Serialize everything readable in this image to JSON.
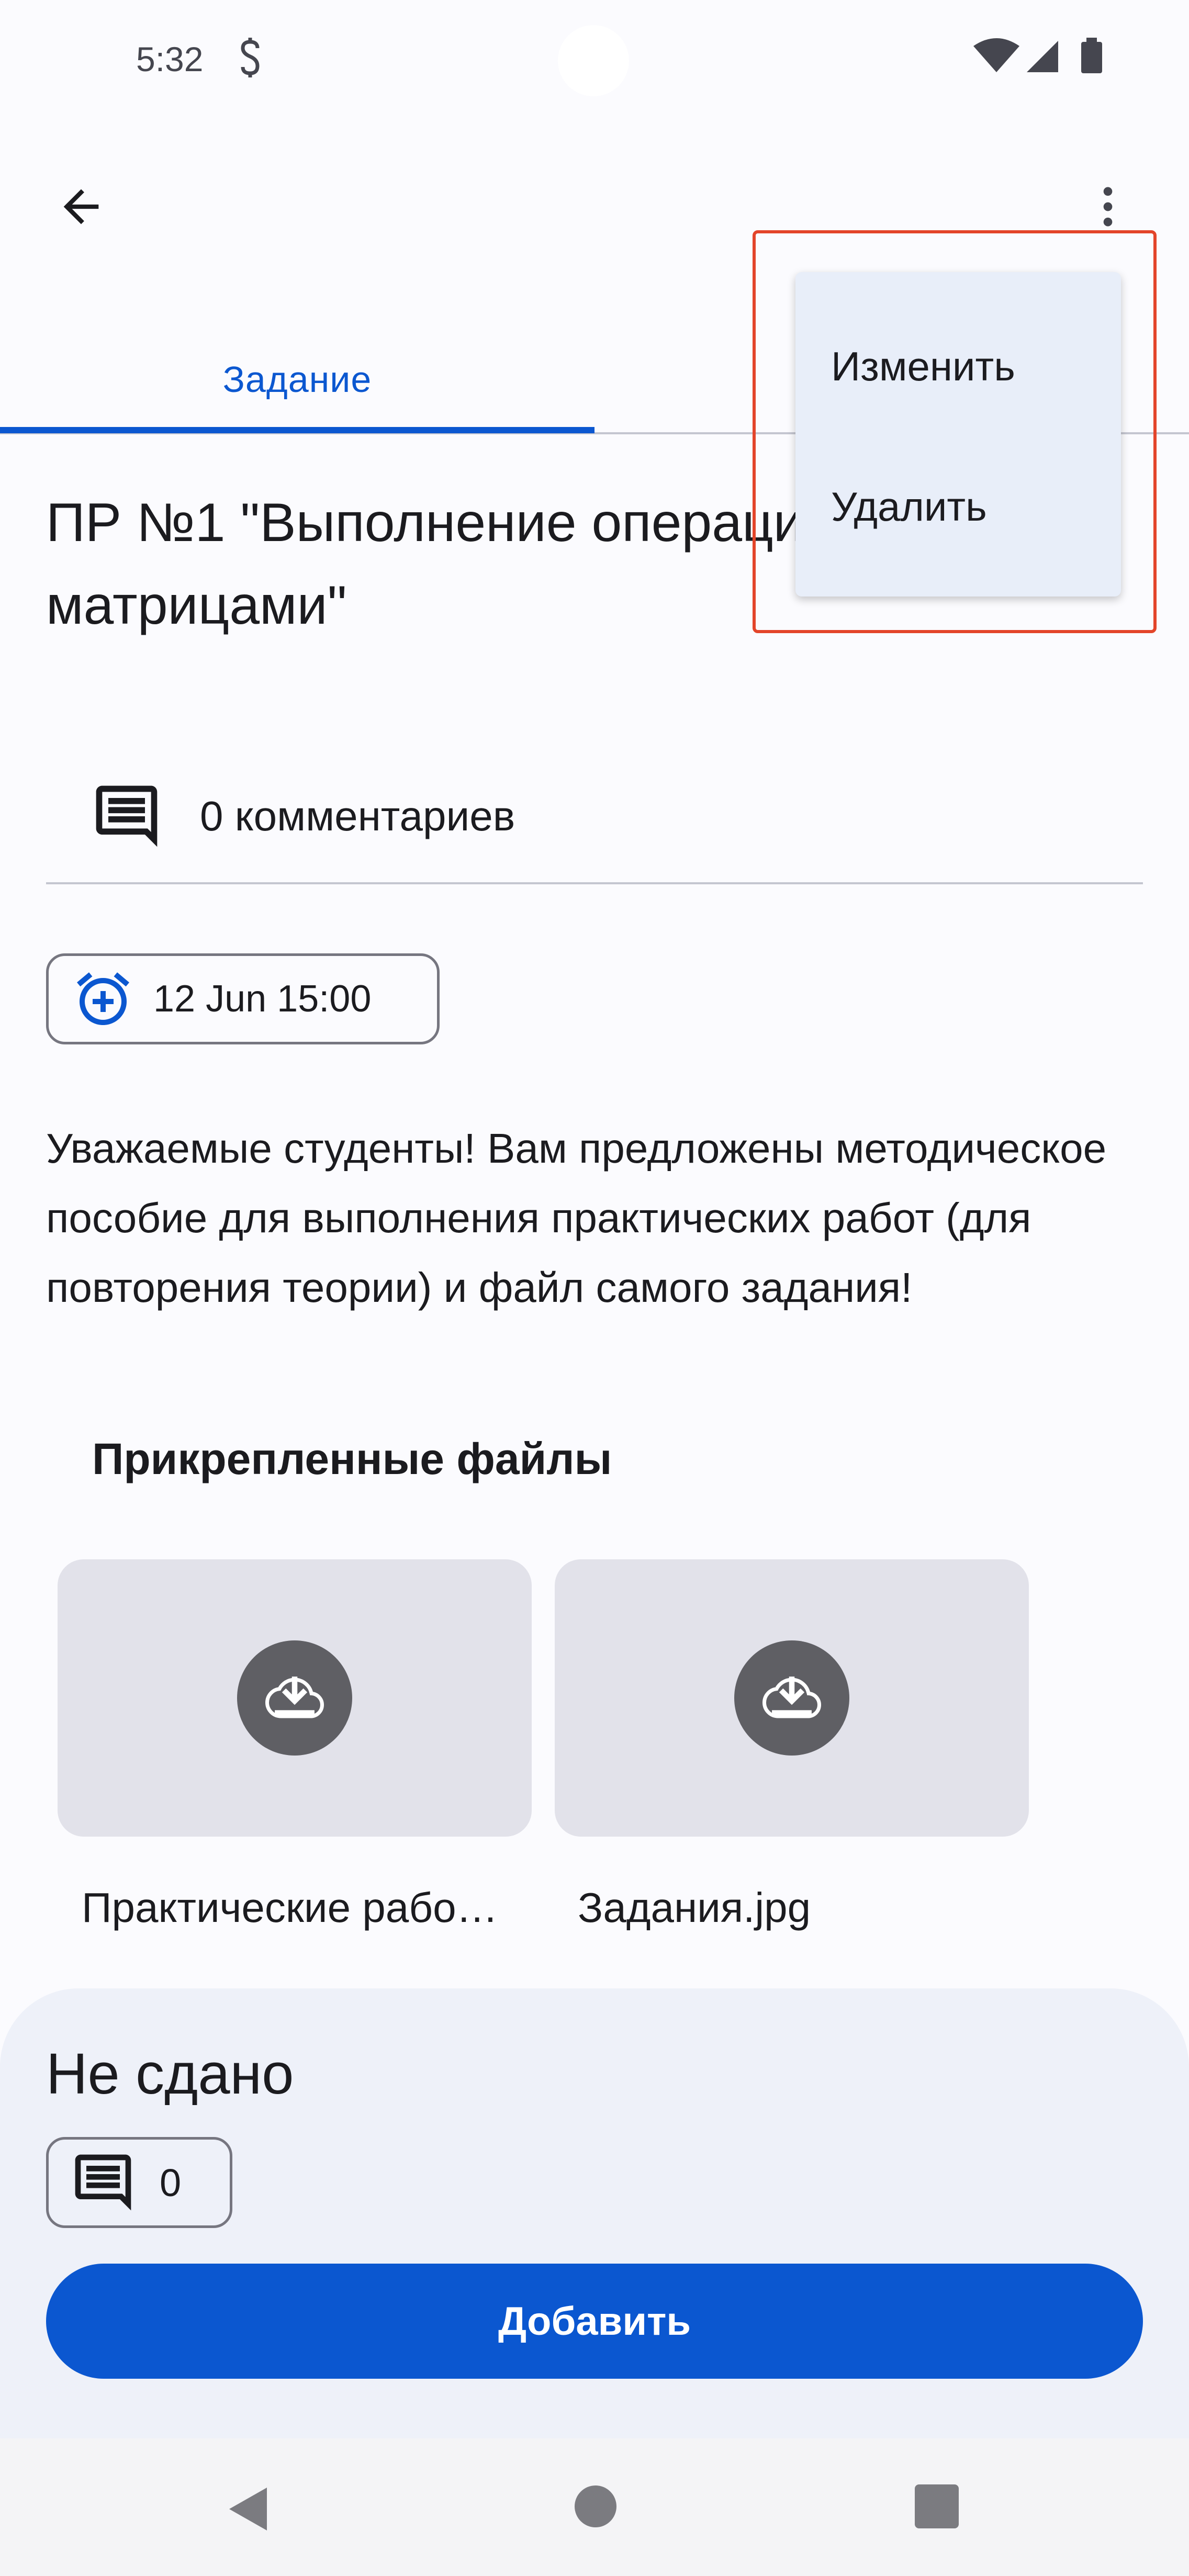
{
  "status_bar": {
    "time": "5:32"
  },
  "app_bar": {
    "back_icon": "arrow-back-icon",
    "more_icon": "more-vert-icon"
  },
  "tabs": {
    "active_label": "Задание"
  },
  "assignment": {
    "title": "ПР №1 \"Выполнение операций с\nматрицами\"",
    "comments_label": "0 комментариев",
    "due": "12 Jun 15:00",
    "description": "Уважаемые студенты! Вам предложены методическое пособие для выполнения практических работ (для повторения теории) и файл самого задания!",
    "attachments_heading": "Прикрепленные файлы",
    "files": [
      {
        "name": "Практические рабо…"
      },
      {
        "name": "Задания.jpg"
      }
    ]
  },
  "submission": {
    "status": "Не сдано",
    "private_comments_count": "0",
    "add_label": "Добавить"
  },
  "menu": {
    "items": [
      {
        "label": "Изменить"
      },
      {
        "label": "Удалить"
      }
    ]
  },
  "colors": {
    "accent": "#0b57d0",
    "highlight": "#e3452a",
    "menu_bg": "#e8eef9",
    "sheet_bg": "#eef1f9"
  }
}
